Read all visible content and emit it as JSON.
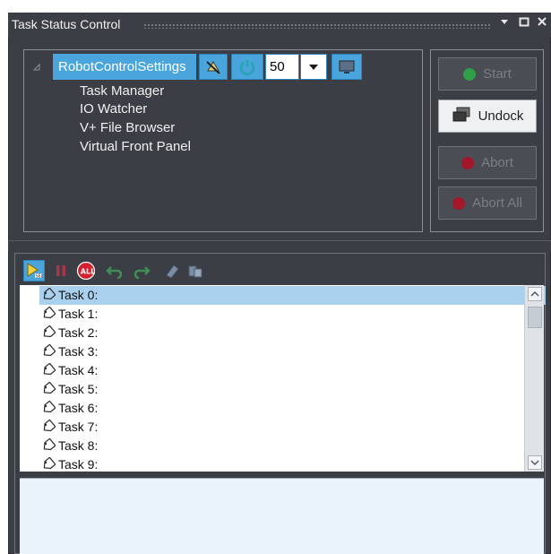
{
  "title": "Task Status Control",
  "titlebar": {
    "icons": [
      "chevron-down-icon",
      "maximize-icon",
      "close-icon"
    ]
  },
  "tree": {
    "root_label": "RobotControlSettings",
    "speed_value": "50",
    "children": [
      "Task Manager",
      "IO Watcher",
      "V+ File Browser",
      "Virtual Front Panel"
    ]
  },
  "buttons": {
    "start": "Start",
    "undock": "Undock",
    "abort": "Abort",
    "abort_all": "Abort All"
  },
  "toolbar_icons": [
    "select-icon",
    "pause-icon",
    "all-icon",
    "undo-icon",
    "redo-icon",
    "erase-icon",
    "copy-icon"
  ],
  "tasks": [
    "Task 0:",
    "Task 1:",
    "Task 2:",
    "Task 3:",
    "Task 4:",
    "Task 5:",
    "Task 6:",
    "Task 7:",
    "Task 8:",
    "Task 9:"
  ],
  "selected_task_index": 0,
  "colors": {
    "window_bg": "#3b3e45",
    "selection_blue": "#4aa5dc",
    "row_selected": "#a9d1ee",
    "start_green": "#2e9e47",
    "abort_red": "#a3172a"
  }
}
